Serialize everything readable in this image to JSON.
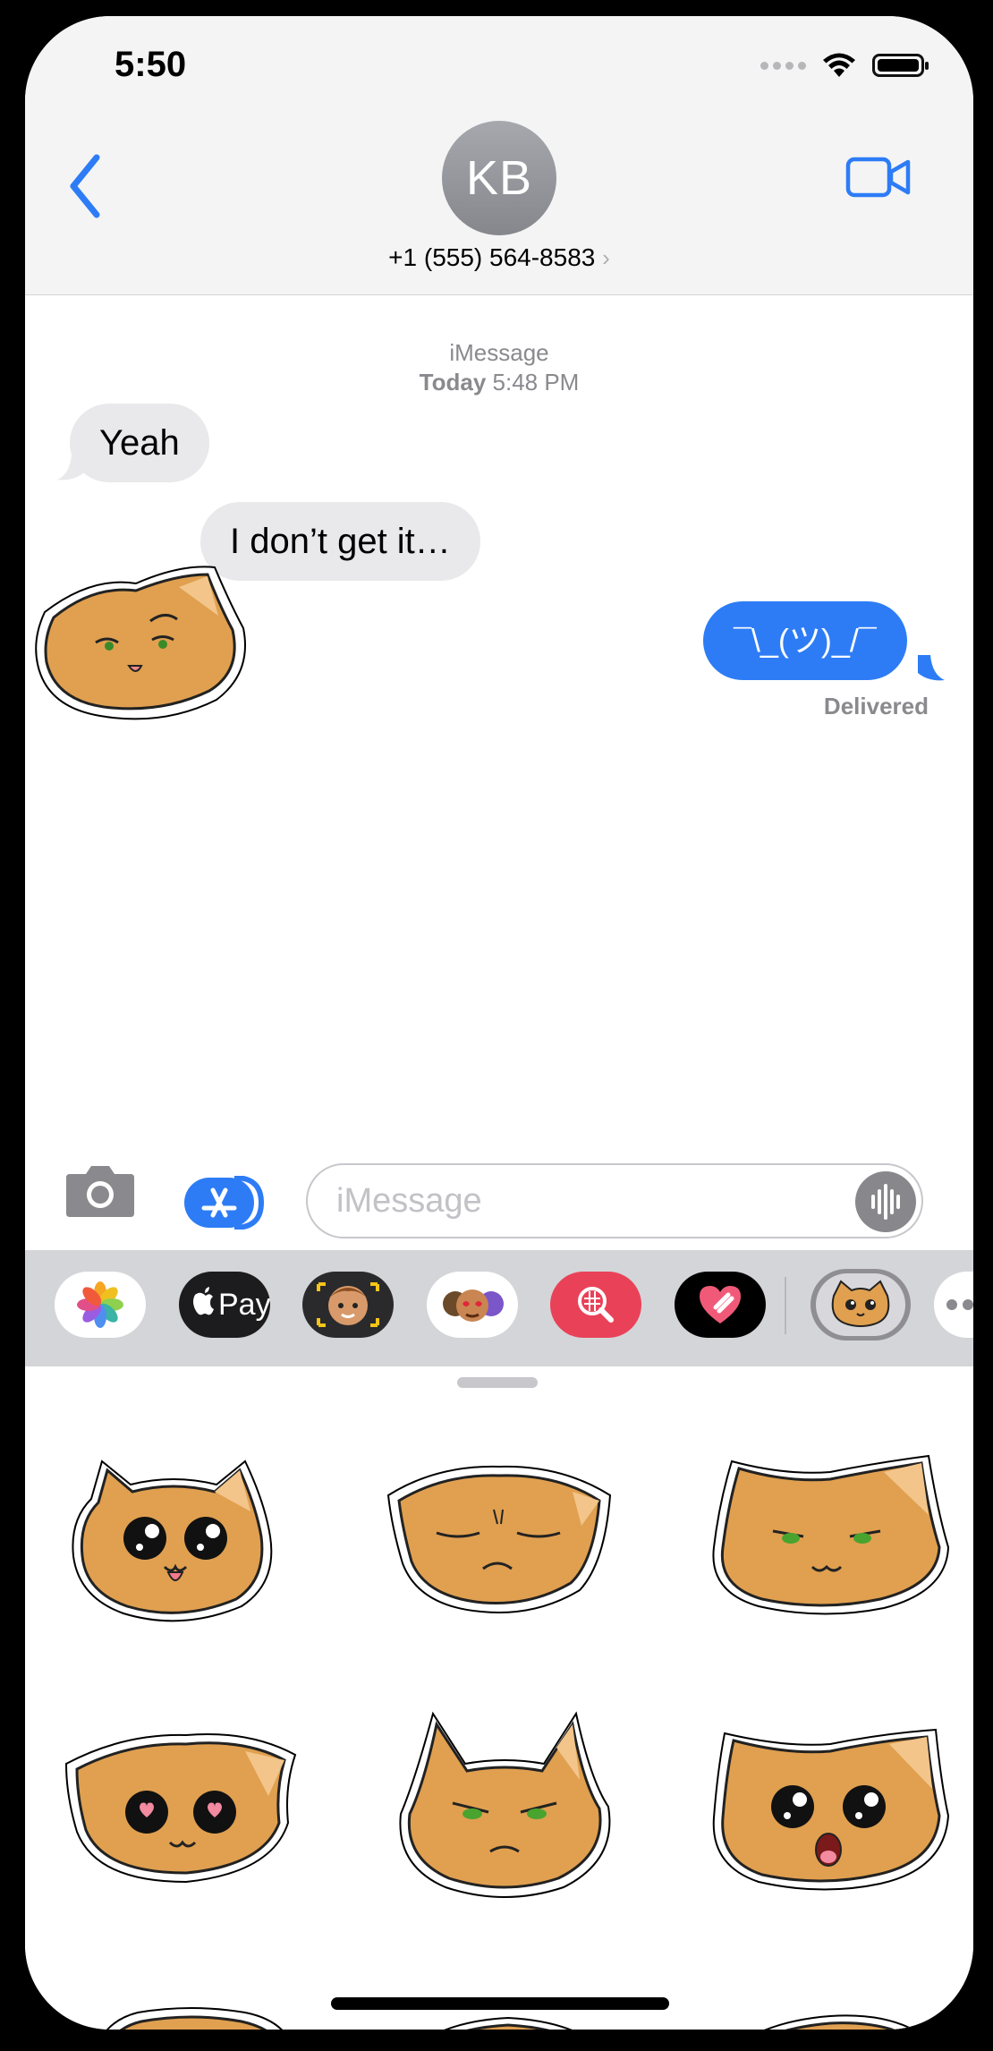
{
  "status": {
    "time": "5:50"
  },
  "header": {
    "avatar_initials": "KB",
    "contact_name": "+1 (555) 564-8583",
    "chevron": "›"
  },
  "conversation": {
    "service": "iMessage",
    "date_label": "Today",
    "time_label": "5:48 PM",
    "messages": [
      {
        "side": "incoming",
        "text": "Yeah"
      },
      {
        "side": "incoming",
        "text": "I don’t get it…"
      },
      {
        "side": "outgoing",
        "text": "¯\\_(ツ)_/¯"
      }
    ],
    "receipt": "Delivered"
  },
  "composer": {
    "placeholder": "iMessage"
  },
  "app_strip": {
    "apps": [
      "photos-icon",
      "apple-pay-icon",
      "memoji-icon",
      "animoji-icon",
      "image-search-icon",
      "digital-touch-icon",
      "cat-stickers-icon",
      "more-icon"
    ],
    "apple_pay_label": "Pay"
  },
  "colors": {
    "accent": "#2d7cf6",
    "incoming_bubble": "#e9e9eb",
    "cat_fill": "#e0a050"
  }
}
